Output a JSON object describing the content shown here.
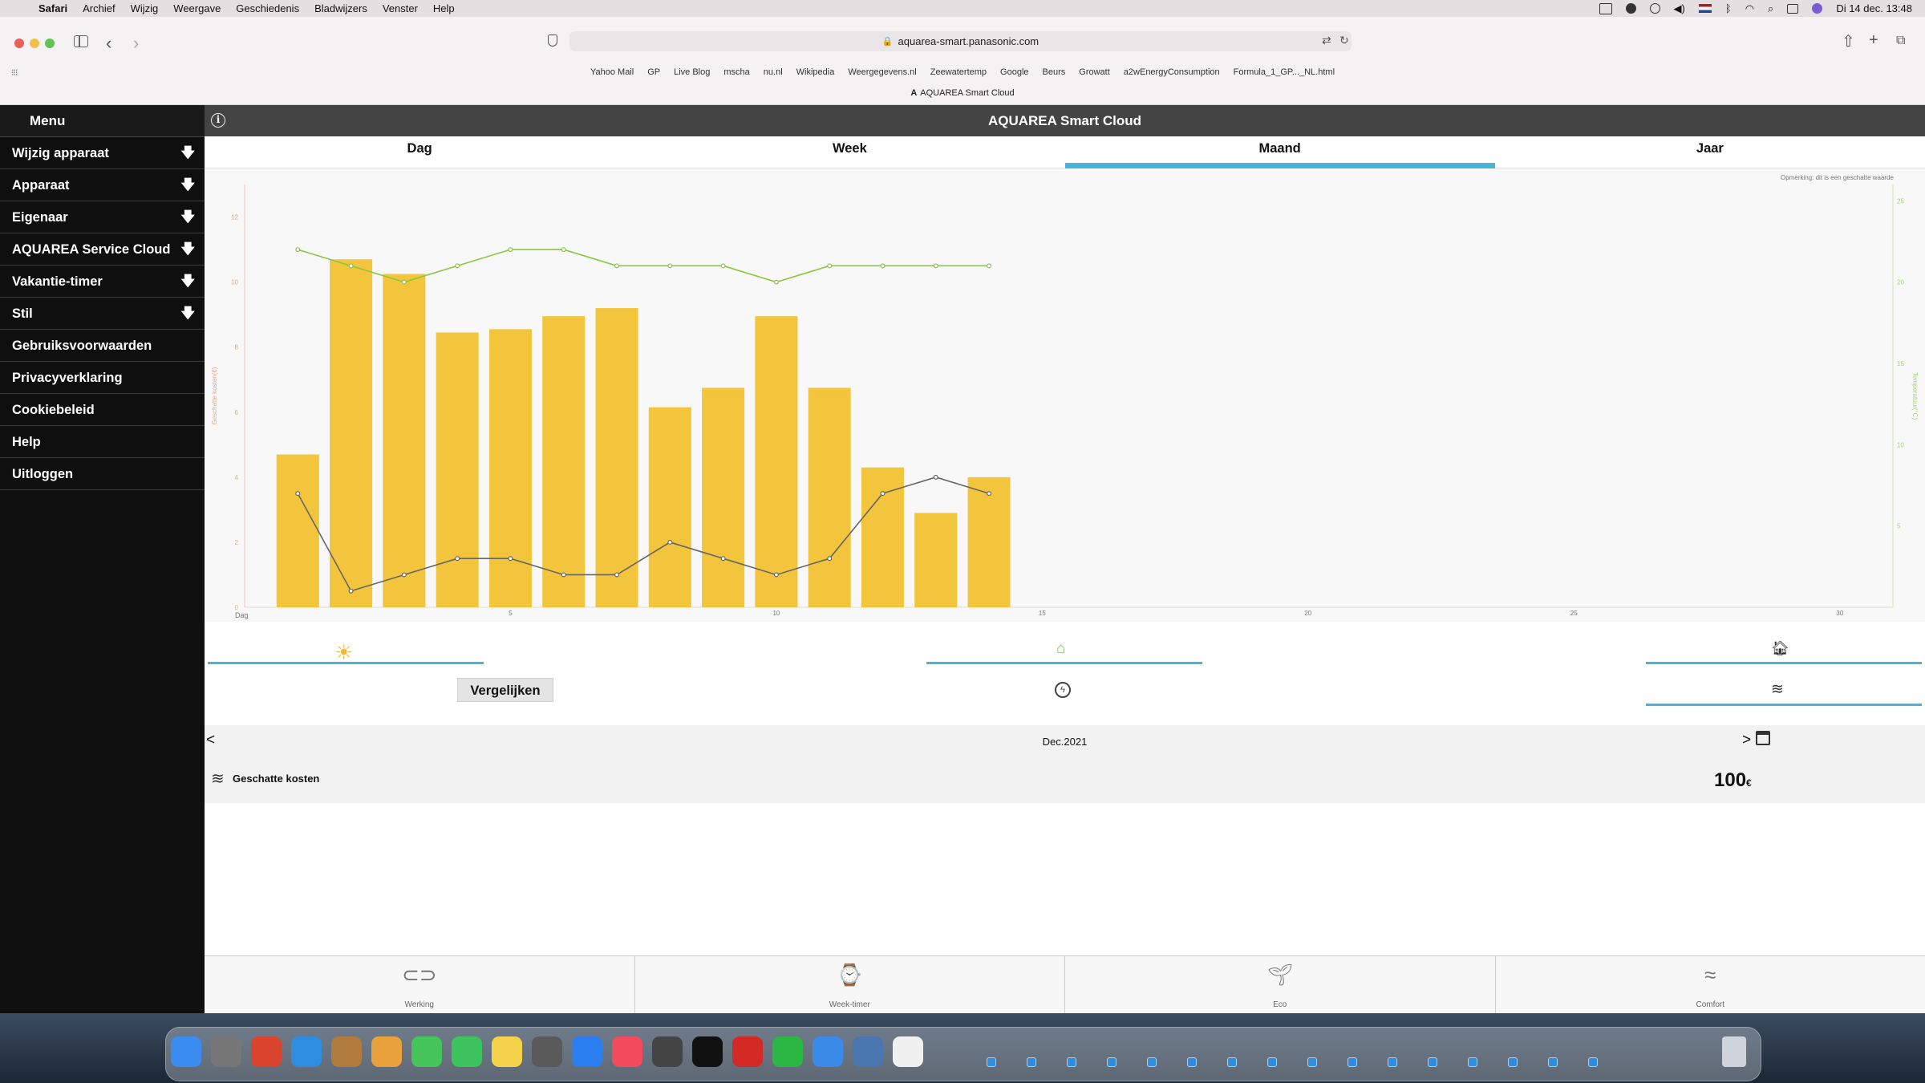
{
  "menubar": {
    "items": [
      "Safari",
      "Archief",
      "Wijzig",
      "Weergave",
      "Geschiedenis",
      "Bladwijzers",
      "Venster",
      "Help"
    ],
    "clock": "Di 14 dec.  13:48"
  },
  "browser": {
    "url": "aquarea-smart.panasonic.com",
    "bookmarks": [
      "Yahoo Mail",
      "GP",
      "Live Blog",
      "mscha",
      "nu.nl",
      "Wikipedia",
      "Weergegevens.nl",
      "Zeewatertemp",
      "Google",
      "Beurs",
      "Growatt",
      "a2wEnergyConsumption",
      "Formula_1_GP..._NL.html"
    ],
    "tab_title": "AQUAREA Smart Cloud"
  },
  "side_menu": {
    "header": "Menu",
    "items": [
      {
        "label": "Wijzig apparaat",
        "expandable": true
      },
      {
        "label": "Apparaat",
        "expandable": true
      },
      {
        "label": "Eigenaar",
        "expandable": true
      },
      {
        "label": "AQUAREA Service Cloud",
        "expandable": true
      },
      {
        "label": "Vakantie-timer",
        "expandable": true
      },
      {
        "label": "Stil",
        "expandable": true
      },
      {
        "label": "Gebruiksvoorwaarden",
        "expandable": false
      },
      {
        "label": "Privacyverklaring",
        "expandable": false
      },
      {
        "label": "Cookiebeleid",
        "expandable": false
      },
      {
        "label": "Help",
        "expandable": false
      },
      {
        "label": "Uitloggen",
        "expandable": false
      }
    ]
  },
  "header": {
    "title": "AQUAREA Smart Cloud"
  },
  "tabs": [
    {
      "label": "Dag",
      "active": false
    },
    {
      "label": "Week",
      "active": false
    },
    {
      "label": "Maand",
      "active": true
    },
    {
      "label": "Jaar",
      "active": false
    }
  ],
  "chart_note": "Opmerking: dit is een geschatte waarde",
  "chart_data": {
    "type": "bar",
    "xlabel": "Dag",
    "ylabel": "Geschatte kosten(€)",
    "y2label": "Temperatuur(°C)",
    "xlim": [
      0,
      31
    ],
    "x_ticks": [
      5,
      10,
      15,
      20,
      25,
      30
    ],
    "ylim": [
      0,
      13
    ],
    "y_ticks": [
      0,
      2,
      4,
      6,
      8,
      10,
      12
    ],
    "y2lim": [
      0,
      26
    ],
    "y2_ticks": [
      5,
      10,
      15,
      20,
      25
    ],
    "bar_color": "#f3c53d",
    "series": [
      {
        "x": [
          1,
          2,
          3,
          4,
          5,
          6,
          7,
          8,
          9,
          10,
          11,
          12,
          13,
          14
        ],
        "values": [
          4.7,
          10.7,
          10.25,
          8.45,
          8.55,
          8.95,
          9.2,
          6.15,
          6.75,
          8.95,
          6.75,
          4.3,
          2.9,
          4.0
        ],
        "axis": "left",
        "color": "#f3c53d",
        "kind": "bar"
      },
      {
        "x": [
          1,
          2,
          3,
          4,
          5,
          6,
          7,
          8,
          9,
          10,
          11,
          12,
          13,
          14
        ],
        "values": [
          22,
          21,
          20,
          21,
          22,
          22,
          21,
          21,
          21,
          20,
          21,
          21,
          21,
          21
        ],
        "axis": "right",
        "color": "#8cc63f",
        "kind": "line"
      },
      {
        "x": [
          1,
          2,
          3,
          4,
          5,
          6,
          7,
          8,
          9,
          10,
          11,
          12,
          13,
          14
        ],
        "values": [
          7,
          1,
          2,
          3,
          3,
          2,
          2,
          4,
          3,
          2,
          3,
          7,
          8,
          7
        ],
        "axis": "right",
        "color": "#666666",
        "kind": "line"
      }
    ]
  },
  "compare_button": "Vergelijken",
  "period": {
    "label": "Dec.2021",
    "prev": "<",
    "next": ">"
  },
  "cost": {
    "label": "Geschatte kosten",
    "value": "100",
    "unit": "€"
  },
  "bottom_nav": [
    {
      "label": "Werking",
      "icon": "toggle-icon"
    },
    {
      "label": "Week-timer",
      "icon": "calendar-clock-icon"
    },
    {
      "label": "Eco",
      "icon": "sprout-icon"
    },
    {
      "label": "Comfort",
      "icon": "waves-icon"
    }
  ]
}
